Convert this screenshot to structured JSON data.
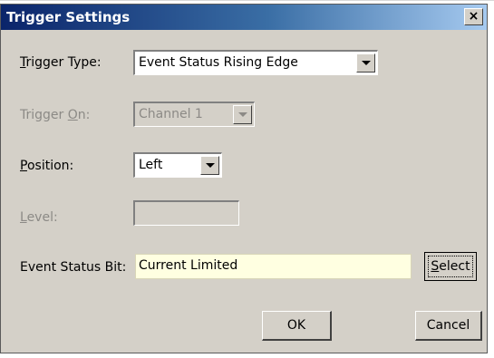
{
  "dialog": {
    "title": "Trigger Settings",
    "close_label": "×"
  },
  "trigger_type": {
    "label_mnemonic": "T",
    "label_rest": "rigger Type:",
    "value": "Event Status Rising Edge"
  },
  "trigger_on": {
    "label_pre": "Trigger ",
    "label_mnemonic": "O",
    "label_rest": "n:",
    "value": "Channel 1"
  },
  "position": {
    "label_mnemonic": "P",
    "label_rest": "osition:",
    "value": "Left"
  },
  "level": {
    "label_mnemonic": "L",
    "label_rest": "evel:",
    "value": ""
  },
  "event_status_bit": {
    "label": "Event Status Bit:",
    "value": "Current Limited",
    "select_mnemonic": "S",
    "select_rest": "elect"
  },
  "buttons": {
    "ok": "OK",
    "cancel": "Cancel"
  },
  "colors": {
    "title_gradient_start": "#0a246a",
    "title_gradient_end": "#a6caf0",
    "dialog_face": "#d4d0c8",
    "disabled_text": "#8c8a86",
    "event_field_bg": "#ffffe1"
  }
}
